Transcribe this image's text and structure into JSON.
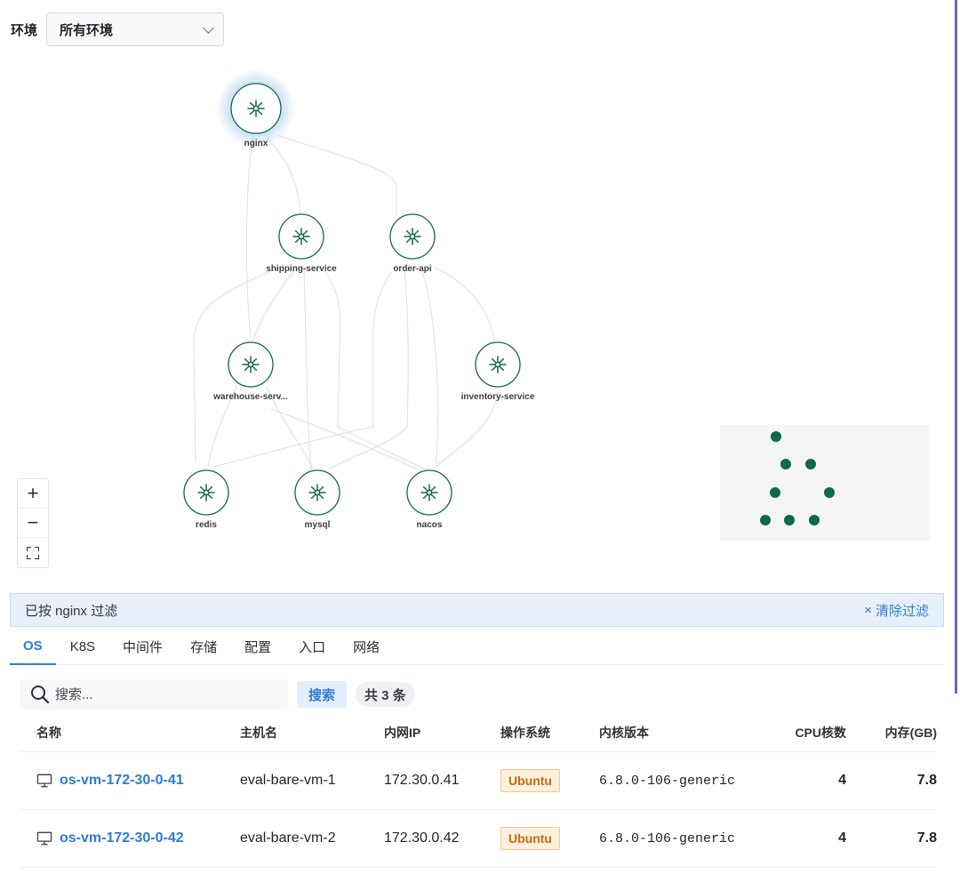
{
  "env": {
    "label": "环境",
    "selected": "所有环境"
  },
  "graph": {
    "nodes": [
      {
        "id": "nginx",
        "label": "nginx",
        "highlight": true
      },
      {
        "id": "shipping",
        "label": "shipping-service"
      },
      {
        "id": "order",
        "label": "order-api"
      },
      {
        "id": "warehouse",
        "label": "warehouse-serv..."
      },
      {
        "id": "inventory",
        "label": "inventory-service"
      },
      {
        "id": "redis",
        "label": "redis"
      },
      {
        "id": "mysql",
        "label": "mysql"
      },
      {
        "id": "nacos",
        "label": "nacos"
      }
    ],
    "node_color": "#0e6a44",
    "highlight_color": "#4a90e2"
  },
  "zoom": {
    "in": "+",
    "out": "−"
  },
  "filter": {
    "text": "已按 nginx 过滤",
    "clear_label": "清除过滤",
    "clear_icon": "×"
  },
  "tabs": [
    {
      "label": "OS",
      "active": true
    },
    {
      "label": "K8S"
    },
    {
      "label": "中间件"
    },
    {
      "label": "存储"
    },
    {
      "label": "配置"
    },
    {
      "label": "入口"
    },
    {
      "label": "网络"
    }
  ],
  "search": {
    "placeholder": "搜索...",
    "button": "搜索",
    "count": "共 3 条"
  },
  "table": {
    "columns": [
      "名称",
      "主机名",
      "内网IP",
      "操作系统",
      "内核版本",
      "CPU核数",
      "内存(GB)"
    ],
    "rows": [
      {
        "name": "os-vm-172-30-0-41",
        "hostname": "eval-bare-vm-1",
        "ip": "172.30.0.41",
        "os": "Ubuntu",
        "kernel": "6.8.0-106-generic",
        "cpu": "4",
        "mem": "7.8"
      },
      {
        "name": "os-vm-172-30-0-42",
        "hostname": "eval-bare-vm-2",
        "ip": "172.30.0.42",
        "os": "Ubuntu",
        "kernel": "6.8.0-106-generic",
        "cpu": "4",
        "mem": "7.8"
      }
    ]
  }
}
